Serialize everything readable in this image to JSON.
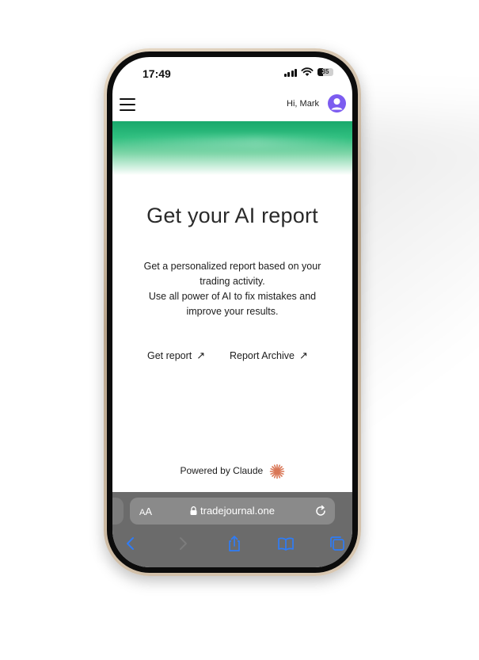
{
  "status_bar": {
    "time": "17:49",
    "battery": "35"
  },
  "header": {
    "greeting": "Hi, Mark"
  },
  "main": {
    "title": "Get your AI report",
    "description_lines": [
      "Get a personalized report based on your",
      "trading activity.",
      "Use all power of AI to fix mistakes and",
      "improve your results."
    ],
    "links": [
      {
        "label": "Get report",
        "arrow": "↗"
      },
      {
        "label": "Report Archive",
        "arrow": "↗"
      }
    ],
    "powered_by": "Powered by Claude"
  },
  "browser": {
    "aa_small": "A",
    "aa_big": "A",
    "url": "tradejournal.one"
  },
  "icons": {
    "menu": "hamburger-icon",
    "avatar": "user-avatar-icon",
    "claude": "claude-burst-icon",
    "lock": "lock-icon",
    "reload": "reload-icon",
    "back": "chevron-left-icon",
    "forward": "chevron-right-icon",
    "share": "share-icon",
    "bookmarks": "book-icon",
    "tabs": "tabs-icon"
  },
  "colors": {
    "accent_green": "#19a86c",
    "avatar_purple": "#7c5cf0",
    "claude_orange": "#d97757",
    "safari_blue": "#2f7cf6"
  }
}
